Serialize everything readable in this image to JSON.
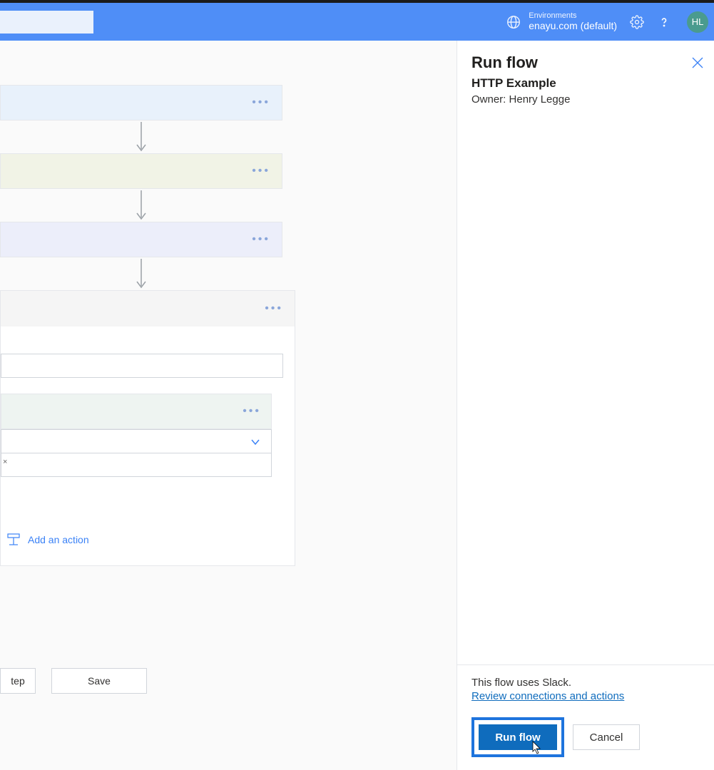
{
  "header": {
    "env_label": "Environments",
    "env_value": "enayu.com (default)",
    "avatar": "HL"
  },
  "canvas": {
    "add_action": "Add an action",
    "step_btn": "tep",
    "save_btn": "Save",
    "tag_close": "×"
  },
  "panel": {
    "title": "Run flow",
    "subtitle": "HTTP Example",
    "owner": "Owner: Henry Legge",
    "uses": "This flow uses Slack.",
    "review": "Review connections and actions",
    "run": "Run flow",
    "cancel": "Cancel"
  }
}
